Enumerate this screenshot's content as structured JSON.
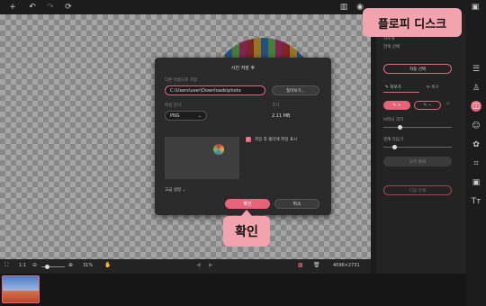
{
  "toolbar": {
    "add_icon": "+",
    "undo_icon": "↶",
    "redo_icon": "↷",
    "refresh_icon": "⟳",
    "compare_icon": "▥",
    "eye_icon": "◉",
    "save_icon": "▣"
  },
  "dialog": {
    "title": "사진 저장 후",
    "path_label": "다른 이름으로 저장",
    "path_value": "C:\\Users\\user\\Downloads\\photo",
    "browse_label": "찾아보기...",
    "format_label": "파일 형식",
    "format_value": "PNG",
    "size_label": "크기",
    "size_value": "2.11 MB",
    "open_folder_label": "저장 후 폴더에 파일 표시",
    "advanced_label": "고급 설정",
    "ok_label": "확인",
    "cancel_label": "취소"
  },
  "callouts": {
    "save": "플로피 디스크",
    "ok": "확인"
  },
  "right_panel": {
    "top_line1": "지우개",
    "top_line2": "한개 선택",
    "auto_select": "자동 선택",
    "tab_erase": "지우기",
    "tab_restore": "복구",
    "brush_size": "브러시 크기",
    "edge_smoothing": "경계 다듬기",
    "disabled_btn": "모두 복원",
    "next_btn": "다음 단계"
  },
  "bottom": {
    "fit": "1:1",
    "zoom": "31%",
    "dimensions": "4096×2731"
  }
}
